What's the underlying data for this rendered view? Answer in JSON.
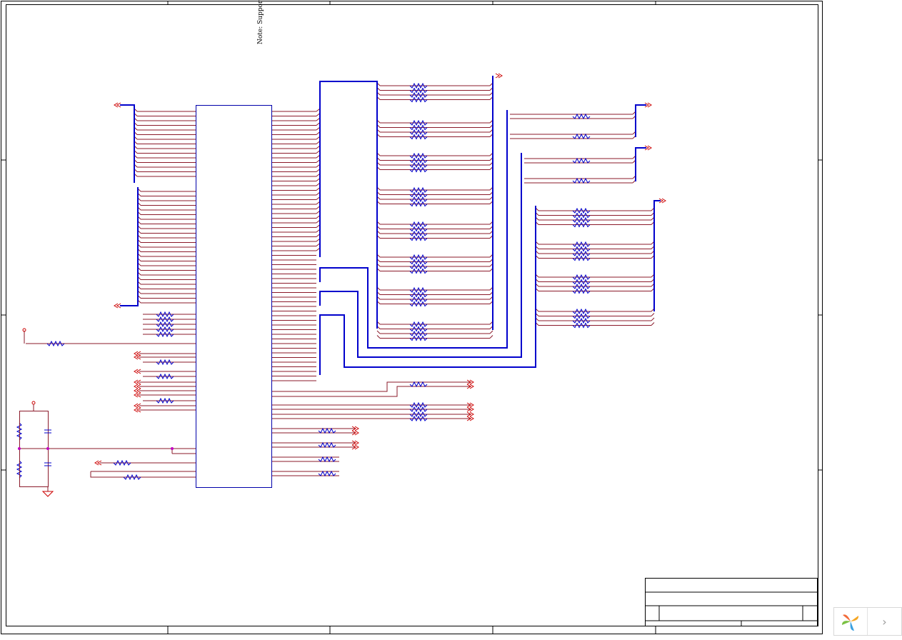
{
  "note": {
    "text": "Note: Support"
  },
  "nav": {
    "next_label": "›"
  },
  "colors": {
    "wire": "#8b1a2a",
    "bus": "#0000cc",
    "component": "#0000aa",
    "power": "#cc0000",
    "frame": "#000000",
    "junction": "#c000c0"
  },
  "icons": {
    "logo": "pinwheel-logo-icon",
    "next": "chevron-right-icon"
  }
}
